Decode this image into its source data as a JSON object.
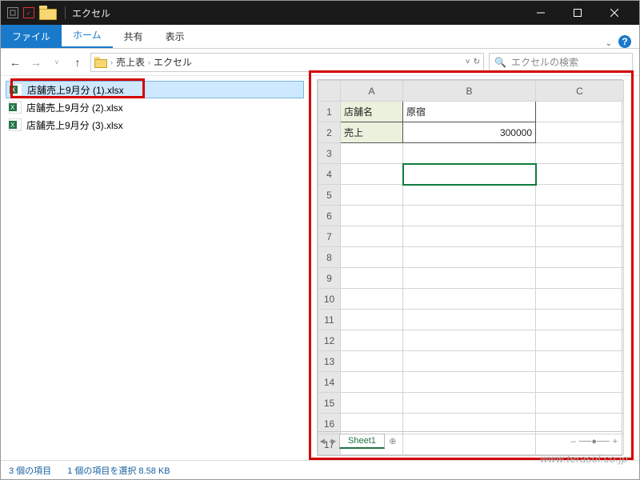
{
  "window": {
    "title": "エクセル"
  },
  "qat": {
    "check": "✓"
  },
  "ribbon": {
    "file": "ファイル",
    "home": "ホーム",
    "share": "共有",
    "view": "表示"
  },
  "nav": {
    "crumb1": "売上表",
    "crumb2": "エクセル",
    "search_placeholder": "エクセルの検索"
  },
  "files": [
    {
      "name": "店舗売上9月分 (1).xlsx"
    },
    {
      "name": "店舗売上9月分 (2).xlsx"
    },
    {
      "name": "店舗売上9月分 (3).xlsx"
    }
  ],
  "sheet": {
    "cols": [
      "A",
      "B",
      "C"
    ],
    "rows": [
      "1",
      "2",
      "3",
      "4",
      "5",
      "6",
      "7",
      "8",
      "9",
      "10",
      "11",
      "12",
      "13",
      "14",
      "15",
      "16",
      "17"
    ],
    "a1": "店舗名",
    "b1": "原宿",
    "a2": "売上",
    "b2": "300000",
    "active_tab": "Sheet1"
  },
  "status": {
    "count": "3 個の項目",
    "selection": "1 個の項目を選択 8.58 KB"
  },
  "watermark": "www.terasol.co.jp"
}
